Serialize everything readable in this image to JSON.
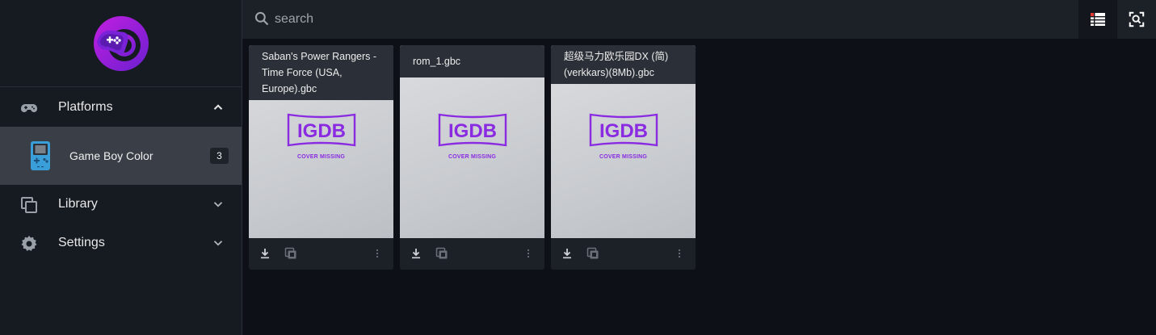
{
  "search": {
    "placeholder": "search"
  },
  "sidebar": {
    "platforms_label": "Platforms",
    "platform_items": [
      {
        "label": "Game Boy Color",
        "count": "3"
      }
    ],
    "library_label": "Library",
    "settings_label": "Settings"
  },
  "games": [
    {
      "title": "Saban's Power Rangers - Time Force (USA, Europe).gbc",
      "cover_logo": "IGDB",
      "cover_text": "COVER MISSING"
    },
    {
      "title": "rom_1.gbc",
      "cover_logo": "IGDB",
      "cover_text": "COVER MISSING"
    },
    {
      "title": "超级马力欧乐园DX (简)(verkkars)(8Mb).gbc",
      "cover_logo": "IGDB",
      "cover_text": "COVER MISSING"
    }
  ],
  "colors": {
    "accent": "#8a2be2",
    "background": "#0d1117",
    "sidebar": "#161b22",
    "selected": "#3a3f47"
  }
}
